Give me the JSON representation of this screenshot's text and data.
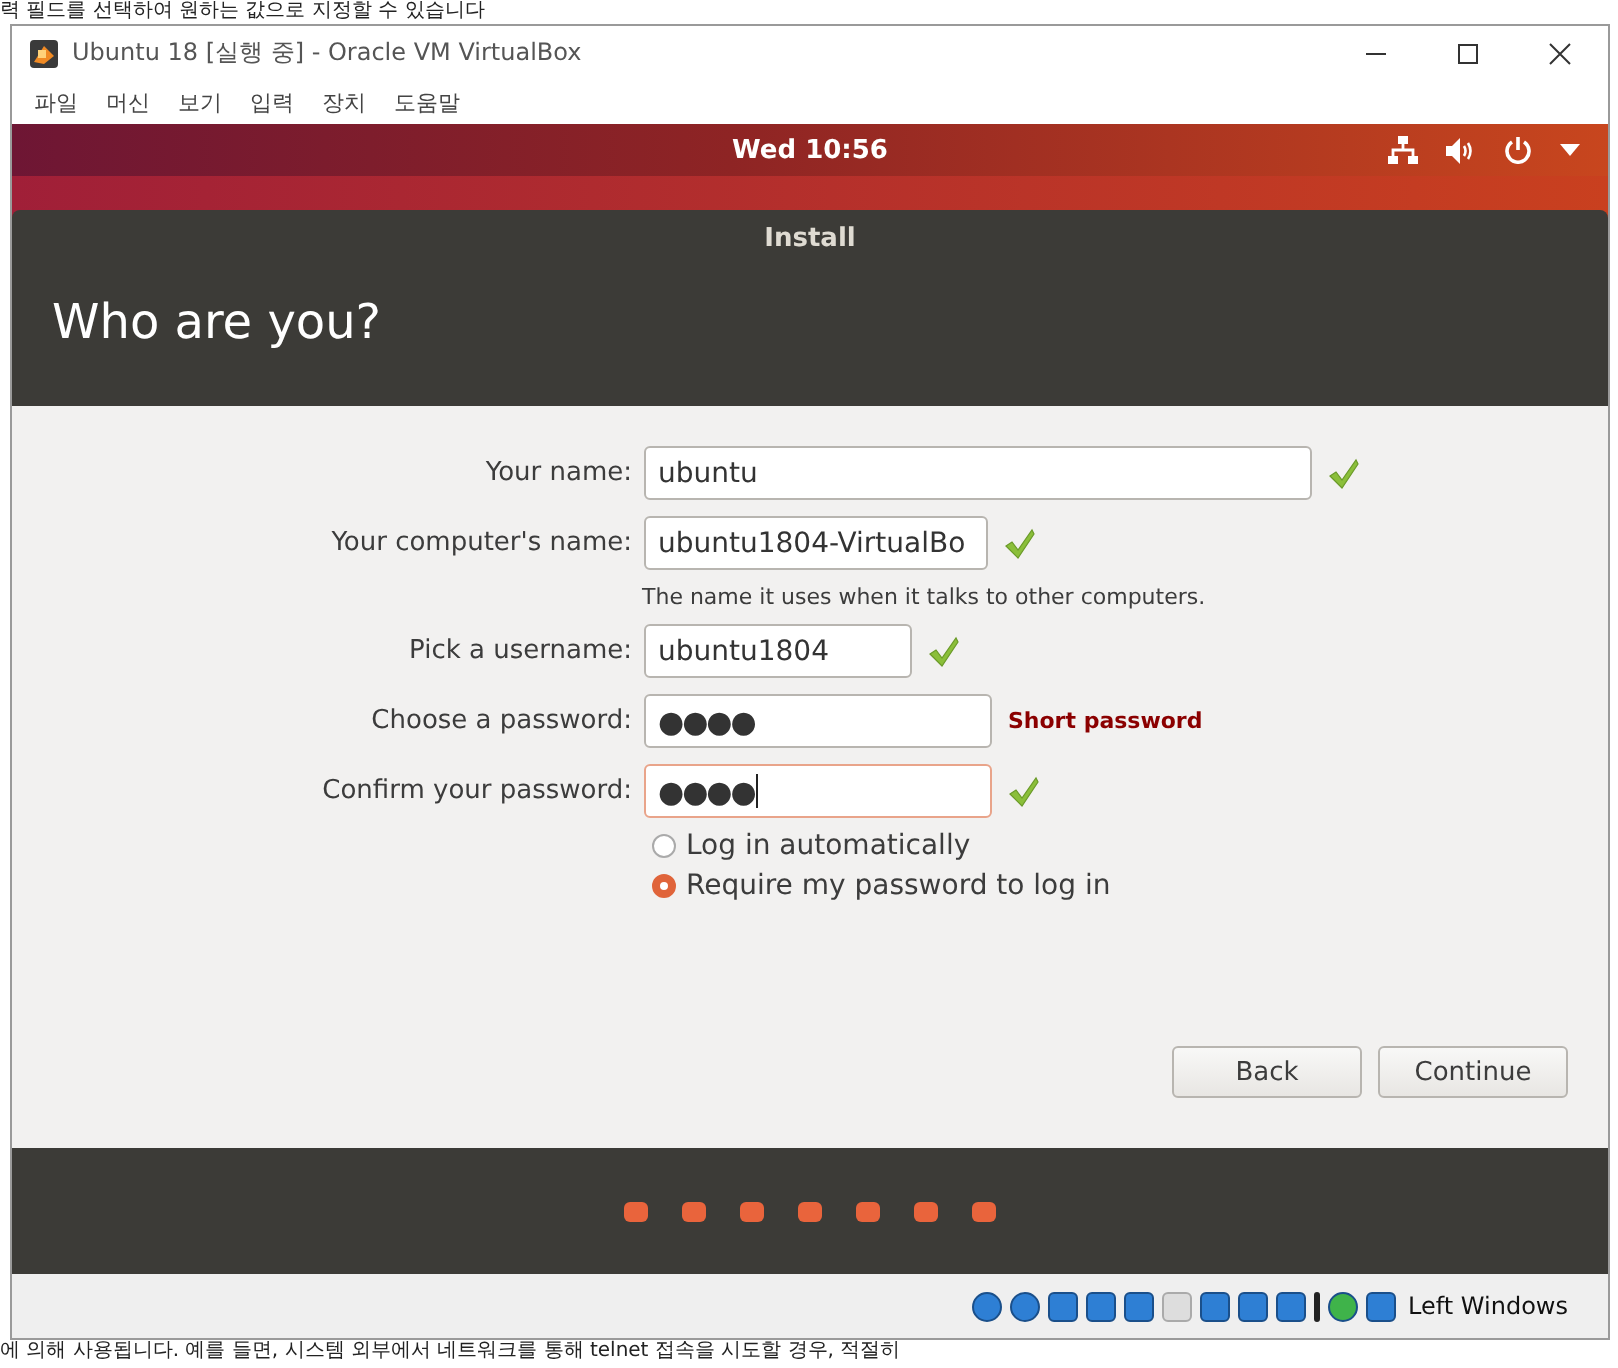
{
  "background_doc": {
    "top_text": "력 필드를 선택하여 원하는 값으로 지정할 수 있습니다",
    "bottom_text": "에 의해 사용됩니다. 예를 들면, 시스템 외부에서 네트워크를 통해 telnet 접속을 시도할 경우, 적절히"
  },
  "window": {
    "title": "Ubuntu 18 [실행 중] - Oracle VM VirtualBox"
  },
  "menu": [
    "파일",
    "머신",
    "보기",
    "입력",
    "장치",
    "도움말"
  ],
  "top_bar": {
    "clock": "Wed 10:56"
  },
  "installer": {
    "title": "Install",
    "heading": "Who are you?",
    "fields": [
      {
        "label": "Your name:",
        "value": "ubuntu",
        "kind": "text",
        "valid": true,
        "focused": false
      },
      {
        "label": "Your computer's name:",
        "value": "ubuntu1804-VirtualBo",
        "kind": "text",
        "valid": true,
        "focused": false,
        "hint": "The name it uses when it talks to other computers."
      },
      {
        "label": "Pick a username:",
        "value": "ubuntu1804",
        "kind": "text",
        "valid": true,
        "focused": false
      },
      {
        "label": "Choose a password:",
        "value": "●●●●",
        "kind": "password",
        "valid": false,
        "focused": false,
        "warning": "Short password"
      },
      {
        "label": "Confirm your password:",
        "value": "●●●●",
        "kind": "password",
        "valid": true,
        "focused": true
      }
    ],
    "login_options": [
      {
        "label": "Log in automatically",
        "selected": false
      },
      {
        "label": "Require my password to log in",
        "selected": true
      }
    ],
    "buttons": [
      "Back",
      "Continue"
    ]
  },
  "status_bar": {
    "host_key": "Left Windows"
  }
}
